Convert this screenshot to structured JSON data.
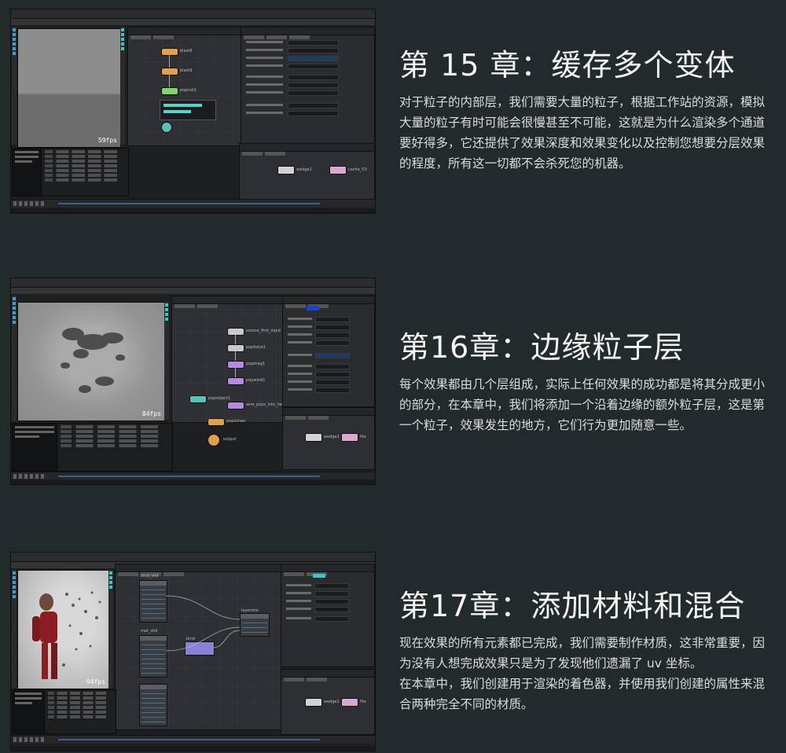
{
  "sections": [
    {
      "title": "第 15 章：缓存多个变体",
      "body": [
        "对于粒子的内部层，我们需要大量的粒子，根据工作站的资源，模拟大量的粒子有时可能会很慢甚至不可能，这就是为什么渲染多个通道要好得多，它还提供了效果深度和效果变化以及控制您想要分层效果的程度，所有这一切都不会杀死您的机器。"
      ],
      "screenshot": {
        "viewport_fps": "59fps",
        "nodes": [
          "blast8",
          "blast9",
          "popnet2"
        ],
        "net_nodes": [
          "wedge1",
          "cache_03"
        ]
      }
    },
    {
      "title": "第16章：边缘粒子层",
      "body": [
        "每个效果都由几个层组成，实际上任何效果的成功都是将其分成更小的部分，在本章中，我们将添加一个沿着边缘的额外粒子层，这是第一个粒子，效果发生的地方，它们行为更加随意一些。"
      ],
      "screenshot": {
        "viewport_fps": "84fps",
        "nodes": [
          "source_first_input",
          "popforce1",
          "popdrag1",
          "popwind1",
          "popobject1",
          "wire_pops_into_here",
          "popsolver",
          "output"
        ],
        "net_nodes": [
          "wedge1",
          "file"
        ]
      }
    },
    {
      "title": "第17章：添加材料和混合",
      "body": [
        "现在效果的所有元素都已完成，我们需要制作材质，这非常重要，因为没有人想完成效果只是为了发现他们遗漏了 uv 坐标。",
        "在本章中，我们创建用于渲染的着色器，并使用我们创建的属性来混合两种完全不同的材质。"
      ],
      "screenshot": {
        "viewport_fps": "94fps",
        "nodes": [
          "bind_shd",
          "mat_shd",
          "layermix",
          "bind"
        ],
        "net_nodes": [
          "wedge1",
          "file"
        ]
      }
    }
  ]
}
